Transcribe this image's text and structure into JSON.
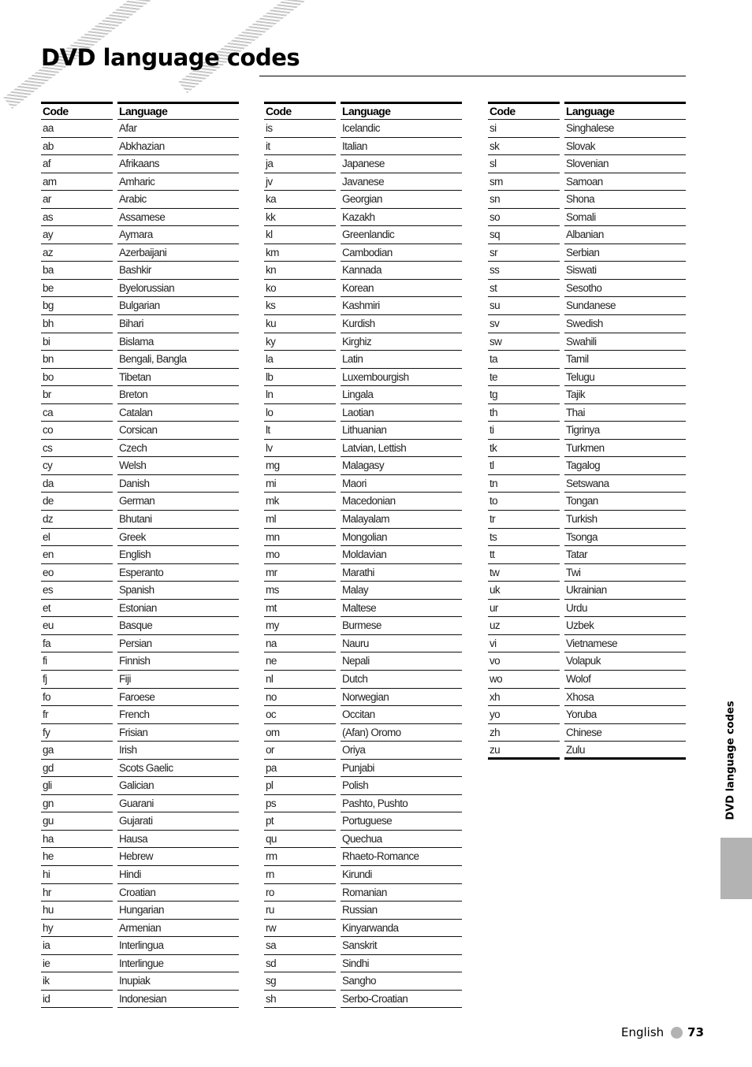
{
  "page": {
    "title": "DVD language codes",
    "side_tab_label": "DVD language codes",
    "footer": {
      "language": "English",
      "page_number": "73"
    }
  },
  "table": {
    "headers": {
      "code": "Code",
      "language": "Language"
    },
    "columns": [
      [
        [
          "aa",
          "Afar"
        ],
        [
          "ab",
          "Abkhazian"
        ],
        [
          "af",
          "Afrikaans"
        ],
        [
          "am",
          "Amharic"
        ],
        [
          "ar",
          "Arabic"
        ],
        [
          "as",
          "Assamese"
        ],
        [
          "ay",
          "Aymara"
        ],
        [
          "az",
          "Azerbaijani"
        ],
        [
          "ba",
          "Bashkir"
        ],
        [
          "be",
          "Byelorussian"
        ],
        [
          "bg",
          "Bulgarian"
        ],
        [
          "bh",
          "Bihari"
        ],
        [
          "bi",
          "Bislama"
        ],
        [
          "bn",
          "Bengali, Bangla"
        ],
        [
          "bo",
          "Tibetan"
        ],
        [
          "br",
          "Breton"
        ],
        [
          "ca",
          "Catalan"
        ],
        [
          "co",
          "Corsican"
        ],
        [
          "cs",
          "Czech"
        ],
        [
          "cy",
          "Welsh"
        ],
        [
          "da",
          "Danish"
        ],
        [
          "de",
          "German"
        ],
        [
          "dz",
          "Bhutani"
        ],
        [
          "el",
          "Greek"
        ],
        [
          "en",
          "English"
        ],
        [
          "eo",
          "Esperanto"
        ],
        [
          "es",
          "Spanish"
        ],
        [
          "et",
          "Estonian"
        ],
        [
          "eu",
          "Basque"
        ],
        [
          "fa",
          "Persian"
        ],
        [
          "fi",
          "Finnish"
        ],
        [
          "fj",
          "Fiji"
        ],
        [
          "fo",
          "Faroese"
        ],
        [
          "fr",
          "French"
        ],
        [
          "fy",
          "Frisian"
        ],
        [
          "ga",
          "Irish"
        ],
        [
          "gd",
          "Scots Gaelic"
        ],
        [
          "gli",
          "Galician"
        ],
        [
          "gn",
          "Guarani"
        ],
        [
          "gu",
          "Gujarati"
        ],
        [
          "ha",
          "Hausa"
        ],
        [
          "he",
          "Hebrew"
        ],
        [
          "hi",
          "Hindi"
        ],
        [
          "hr",
          "Croatian"
        ],
        [
          "hu",
          "Hungarian"
        ],
        [
          "hy",
          "Armenian"
        ],
        [
          "ia",
          "Interlingua"
        ],
        [
          "ie",
          "Interlingue"
        ],
        [
          "ik",
          "Inupiak"
        ],
        [
          "id",
          "Indonesian"
        ]
      ],
      [
        [
          "is",
          "Icelandic"
        ],
        [
          "it",
          "Italian"
        ],
        [
          "ja",
          "Japanese"
        ],
        [
          "jv",
          "Javanese"
        ],
        [
          "ka",
          "Georgian"
        ],
        [
          "kk",
          "Kazakh"
        ],
        [
          "kl",
          "Greenlandic"
        ],
        [
          "km",
          "Cambodian"
        ],
        [
          "kn",
          "Kannada"
        ],
        [
          "ko",
          "Korean"
        ],
        [
          "ks",
          "Kashmiri"
        ],
        [
          "ku",
          "Kurdish"
        ],
        [
          "ky",
          "Kirghiz"
        ],
        [
          "la",
          "Latin"
        ],
        [
          "lb",
          "Luxembourgish"
        ],
        [
          "ln",
          "Lingala"
        ],
        [
          "lo",
          "Laotian"
        ],
        [
          "lt",
          "Lithuanian"
        ],
        [
          "lv",
          "Latvian, Lettish"
        ],
        [
          "mg",
          "Malagasy"
        ],
        [
          "mi",
          "Maori"
        ],
        [
          "mk",
          "Macedonian"
        ],
        [
          "ml",
          "Malayalam"
        ],
        [
          "mn",
          "Mongolian"
        ],
        [
          "mo",
          "Moldavian"
        ],
        [
          "mr",
          "Marathi"
        ],
        [
          "ms",
          "Malay"
        ],
        [
          "mt",
          "Maltese"
        ],
        [
          "my",
          "Burmese"
        ],
        [
          "na",
          "Nauru"
        ],
        [
          "ne",
          "Nepali"
        ],
        [
          "nl",
          "Dutch"
        ],
        [
          "no",
          "Norwegian"
        ],
        [
          "oc",
          "Occitan"
        ],
        [
          "om",
          "(Afan) Oromo"
        ],
        [
          "or",
          "Oriya"
        ],
        [
          "pa",
          "Punjabi"
        ],
        [
          "pl",
          "Polish"
        ],
        [
          "ps",
          "Pashto, Pushto"
        ],
        [
          "pt",
          "Portuguese"
        ],
        [
          "qu",
          "Quechua"
        ],
        [
          "rm",
          "Rhaeto-Romance"
        ],
        [
          "rn",
          "Kirundi"
        ],
        [
          "ro",
          "Romanian"
        ],
        [
          "ru",
          "Russian"
        ],
        [
          "rw",
          "Kinyarwanda"
        ],
        [
          "sa",
          "Sanskrit"
        ],
        [
          "sd",
          "Sindhi"
        ],
        [
          "sg",
          "Sangho"
        ],
        [
          "sh",
          "Serbo-Croatian"
        ]
      ],
      [
        [
          "si",
          "Singhalese"
        ],
        [
          "sk",
          "Slovak"
        ],
        [
          "sl",
          "Slovenian"
        ],
        [
          "sm",
          "Samoan"
        ],
        [
          "sn",
          "Shona"
        ],
        [
          "so",
          "Somali"
        ],
        [
          "sq",
          "Albanian"
        ],
        [
          "sr",
          "Serbian"
        ],
        [
          "ss",
          "Siswati"
        ],
        [
          "st",
          "Sesotho"
        ],
        [
          "su",
          "Sundanese"
        ],
        [
          "sv",
          "Swedish"
        ],
        [
          "sw",
          "Swahili"
        ],
        [
          "ta",
          "Tamil"
        ],
        [
          "te",
          "Telugu"
        ],
        [
          "tg",
          "Tajik"
        ],
        [
          "th",
          "Thai"
        ],
        [
          "ti",
          "Tigrinya"
        ],
        [
          "tk",
          "Turkmen"
        ],
        [
          "tl",
          "Tagalog"
        ],
        [
          "tn",
          "Setswana"
        ],
        [
          "to",
          "Tongan"
        ],
        [
          "tr",
          "Turkish"
        ],
        [
          "ts",
          "Tsonga"
        ],
        [
          "tt",
          "Tatar"
        ],
        [
          "tw",
          "Twi"
        ],
        [
          "uk",
          "Ukrainian"
        ],
        [
          "ur",
          "Urdu"
        ],
        [
          "uz",
          "Uzbek"
        ],
        [
          "vi",
          "Vietnamese"
        ],
        [
          "vo",
          "Volapuk"
        ],
        [
          "wo",
          "Wolof"
        ],
        [
          "xh",
          "Xhosa"
        ],
        [
          "yo",
          "Yoruba"
        ],
        [
          "zh",
          "Chinese"
        ],
        [
          "zu",
          "Zulu"
        ]
      ]
    ]
  },
  "colors": {
    "accent_gray": "#b3b3b3",
    "text": "#111111",
    "rule": "#000000"
  }
}
